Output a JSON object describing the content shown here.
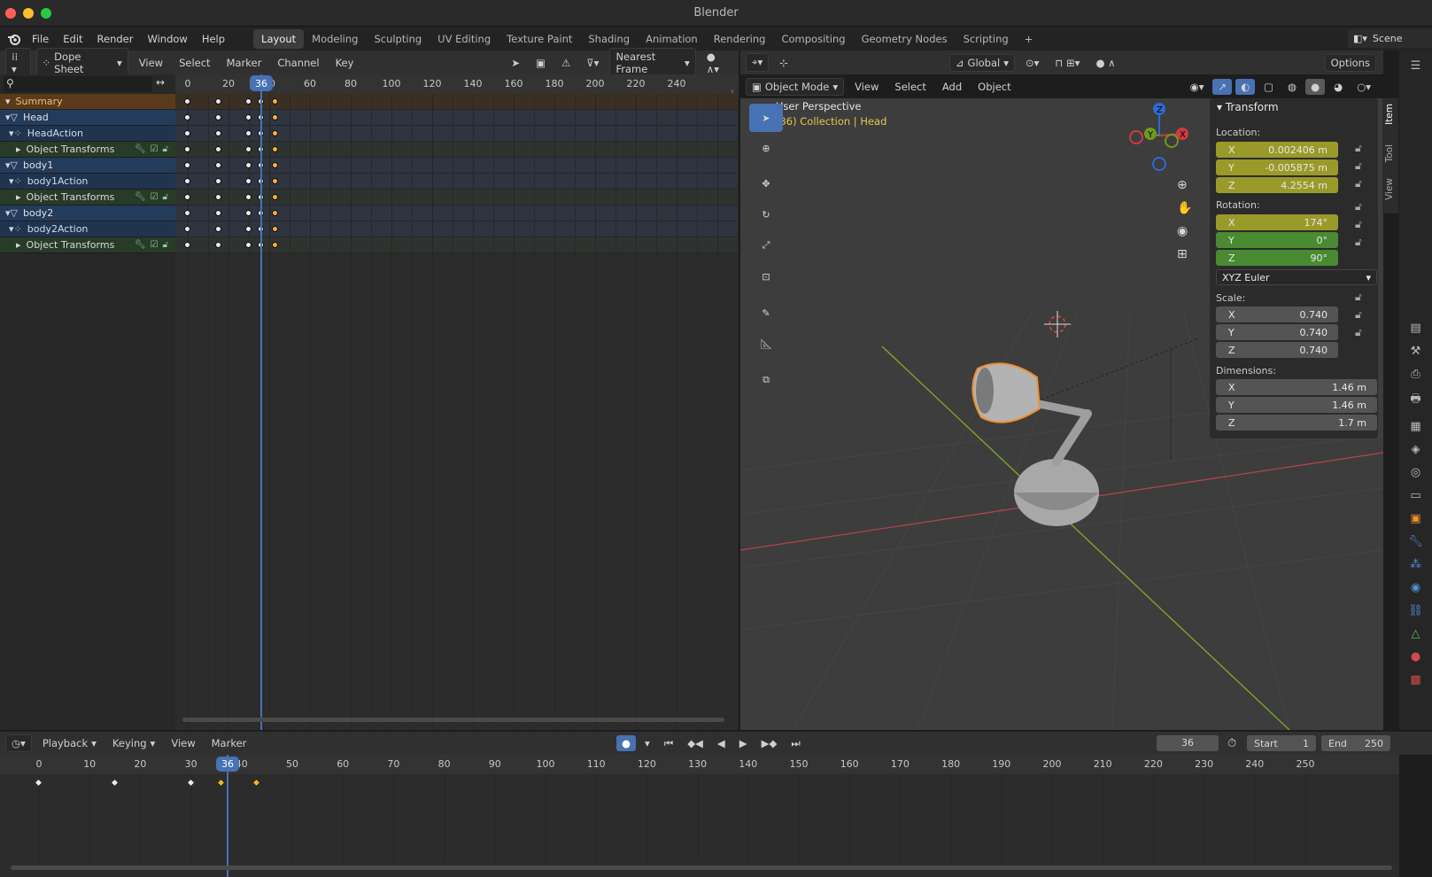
{
  "window": {
    "title": "Blender"
  },
  "topbar": {
    "menu": [
      "File",
      "Edit",
      "Render",
      "Window",
      "Help"
    ],
    "workspaces": [
      "Layout",
      "Modeling",
      "Sculpting",
      "UV Editing",
      "Texture Paint",
      "Shading",
      "Animation",
      "Rendering",
      "Compositing",
      "Geometry Nodes",
      "Scripting"
    ],
    "active_workspace": "Layout",
    "scene_label": "Scene"
  },
  "dopesheet": {
    "mode": "Dope Sheet",
    "menu": [
      "View",
      "Select",
      "Marker",
      "Channel",
      "Key"
    ],
    "snap": "Nearest Frame",
    "current_frame": "36",
    "ruler": [
      "0",
      "20",
      "40",
      "60",
      "80",
      "100",
      "120",
      "140",
      "160",
      "180",
      "200",
      "220",
      "240"
    ],
    "channels": [
      {
        "label": "Summary",
        "kind": "summary"
      },
      {
        "label": "Head",
        "kind": "object"
      },
      {
        "label": "HeadAction",
        "kind": "action"
      },
      {
        "label": "Object Transforms",
        "kind": "group"
      },
      {
        "label": "body1",
        "kind": "object"
      },
      {
        "label": "body1Action",
        "kind": "action"
      },
      {
        "label": "Object Transforms",
        "kind": "group"
      },
      {
        "label": "body2",
        "kind": "object"
      },
      {
        "label": "body2Action",
        "kind": "action"
      },
      {
        "label": "Object Transforms",
        "kind": "group"
      }
    ],
    "keyframes": [
      0,
      15,
      30,
      36,
      43
    ],
    "selected_keyframe": 43
  },
  "viewport": {
    "mode": "Object Mode",
    "menu": [
      "View",
      "Select",
      "Add",
      "Object"
    ],
    "orientation": "Global",
    "options_label": "Options",
    "overlay_title": "User Perspective",
    "overlay_sub": "(36) Collection | Head",
    "gizmo_axes": [
      "X",
      "Y",
      "Z"
    ]
  },
  "npanel": {
    "tabs": [
      "Item",
      "Tool",
      "View"
    ],
    "section": "Transform",
    "location_label": "Location:",
    "location": [
      {
        "axis": "X",
        "value": "0.002406 m"
      },
      {
        "axis": "Y",
        "value": "-0.005875 m"
      },
      {
        "axis": "Z",
        "value": "4.2554 m"
      }
    ],
    "rotation_label": "Rotation:",
    "rotation": [
      {
        "axis": "X",
        "value": "174°"
      },
      {
        "axis": "Y",
        "value": "0°"
      },
      {
        "axis": "Z",
        "value": "90°"
      }
    ],
    "rotation_mode": "XYZ Euler",
    "scale_label": "Scale:",
    "scale": [
      {
        "axis": "X",
        "value": "0.740"
      },
      {
        "axis": "Y",
        "value": "0.740"
      },
      {
        "axis": "Z",
        "value": "0.740"
      }
    ],
    "dimensions_label": "Dimensions:",
    "dimensions": [
      {
        "axis": "X",
        "value": "1.46 m"
      },
      {
        "axis": "Y",
        "value": "1.46 m"
      },
      {
        "axis": "Z",
        "value": "1.7 m"
      }
    ]
  },
  "timeline": {
    "menu": [
      "Playback",
      "Keying",
      "View",
      "Marker"
    ],
    "current_frame": "36",
    "start_label": "Start",
    "start": "1",
    "end_label": "End",
    "end": "250",
    "ruler": [
      "0",
      "10",
      "20",
      "30",
      "40",
      "50",
      "60",
      "70",
      "80",
      "90",
      "100",
      "110",
      "120",
      "130",
      "140",
      "150",
      "160",
      "170",
      "180",
      "190",
      "200",
      "210",
      "220",
      "230",
      "240",
      "250"
    ],
    "keyframes": [
      0,
      15,
      30,
      36,
      43
    ]
  },
  "colors": {
    "accent": "#4772b3",
    "selected_key": "#f2b233",
    "object_outline": "#f0902a",
    "x_axis": "#d03a42",
    "y_axis": "#6e9a1e",
    "z_axis": "#2d6ad0"
  }
}
